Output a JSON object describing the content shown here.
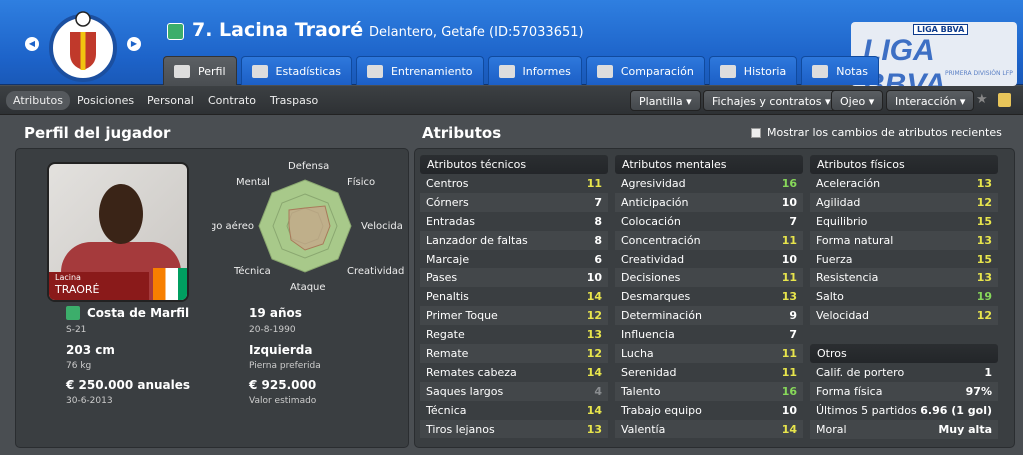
{
  "header": {
    "player_name": "7. Lacina Traoré",
    "player_sub": "Delantero, Getafe (ID:57033651)",
    "league_top": "LIGA BBVA",
    "league_main": "LIGA BBVA",
    "league_foot": "PRIMERA DIVISIÓN LFP"
  },
  "tabs": [
    {
      "label": "Perfil",
      "icon": "profile-icon"
    },
    {
      "label": "Estadísticas",
      "icon": "stats-icon"
    },
    {
      "label": "Entrenamiento",
      "icon": "training-icon"
    },
    {
      "label": "Informes",
      "icon": "reports-icon"
    },
    {
      "label": "Comparación",
      "icon": "compare-icon"
    },
    {
      "label": "Historia",
      "icon": "history-icon"
    },
    {
      "label": "Notas",
      "icon": "notes-icon"
    }
  ],
  "subtabs": [
    "Atributos",
    "Posiciones",
    "Personal",
    "Contrato",
    "Traspaso"
  ],
  "dropdowns": [
    "Plantilla",
    "Fichajes y contratos",
    "Ojeo",
    "Interacción"
  ],
  "profile": {
    "title": "Perfil del jugador",
    "photo_first": "Lacina",
    "photo_last": "TRAORÉ",
    "radar": {
      "top": "Defensa",
      "tr": "Físico",
      "right": "Velocida",
      "br": "Creatividad",
      "bottom": "Ataque",
      "bl": "Técnica",
      "left": "Juego aéreo",
      "tl": "Mental"
    },
    "info": [
      {
        "main": "Costa de Marfil",
        "sub": "S-21"
      },
      {
        "main": "19 años",
        "sub": "20-8-1990"
      },
      {
        "main": "203 cm",
        "sub": "76 kg"
      },
      {
        "main": "Izquierda",
        "sub": "Pierna preferida"
      },
      {
        "main": "€ 250.000 anuales",
        "sub": "30-6-2013"
      },
      {
        "main": "€ 925.000",
        "sub": "Valor estimado"
      }
    ]
  },
  "attributes": {
    "title": "Atributos",
    "show_changes": "Mostrar los cambios de atributos recientes",
    "technical": {
      "title": "Atributos técnicos",
      "rows": [
        [
          "Centros",
          "11",
          "y"
        ],
        [
          "Córners",
          "7",
          "w"
        ],
        [
          "Entradas",
          "8",
          "w"
        ],
        [
          "Lanzador de faltas",
          "8",
          "w"
        ],
        [
          "Marcaje",
          "6",
          "w"
        ],
        [
          "Pases",
          "10",
          "w"
        ],
        [
          "Penaltis",
          "14",
          "y"
        ],
        [
          "Primer Toque",
          "12",
          "y"
        ],
        [
          "Regate",
          "13",
          "y"
        ],
        [
          "Remate",
          "12",
          "y"
        ],
        [
          "Remates cabeza",
          "14",
          "y"
        ],
        [
          "Saques largos",
          "4",
          "gr"
        ],
        [
          "Técnica",
          "14",
          "y"
        ],
        [
          "Tiros lejanos",
          "13",
          "y"
        ]
      ]
    },
    "mental": {
      "title": "Atributos mentales",
      "rows": [
        [
          "Agresividad",
          "16",
          "g"
        ],
        [
          "Anticipación",
          "10",
          "w"
        ],
        [
          "Colocación",
          "7",
          "w"
        ],
        [
          "Concentración",
          "11",
          "y"
        ],
        [
          "Creatividad",
          "10",
          "w"
        ],
        [
          "Decisiones",
          "11",
          "y"
        ],
        [
          "Desmarques",
          "13",
          "y"
        ],
        [
          "Determinación",
          "9",
          "w"
        ],
        [
          "Influencia",
          "7",
          "w"
        ],
        [
          "Lucha",
          "11",
          "y"
        ],
        [
          "Serenidad",
          "11",
          "y"
        ],
        [
          "Talento",
          "16",
          "g"
        ],
        [
          "Trabajo equipo",
          "10",
          "w"
        ],
        [
          "Valentía",
          "14",
          "y"
        ]
      ]
    },
    "physical": {
      "title": "Atributos físicos",
      "rows": [
        [
          "Aceleración",
          "13",
          "y"
        ],
        [
          "Agilidad",
          "12",
          "y"
        ],
        [
          "Equilibrio",
          "15",
          "y"
        ],
        [
          "Forma natural",
          "13",
          "y"
        ],
        [
          "Fuerza",
          "15",
          "y"
        ],
        [
          "Resistencia",
          "13",
          "y"
        ],
        [
          "Salto",
          "19",
          "g"
        ],
        [
          "Velocidad",
          "12",
          "y"
        ]
      ]
    },
    "other": {
      "title": "Otros",
      "rows": [
        [
          "Calif. de portero",
          "1",
          "w"
        ],
        [
          "Forma física",
          "97%",
          "w"
        ],
        [
          "Últimos 5 partidos",
          "6.96 (1 gol)",
          "w"
        ],
        [
          "Moral",
          "Muy alta",
          "w"
        ]
      ]
    }
  }
}
